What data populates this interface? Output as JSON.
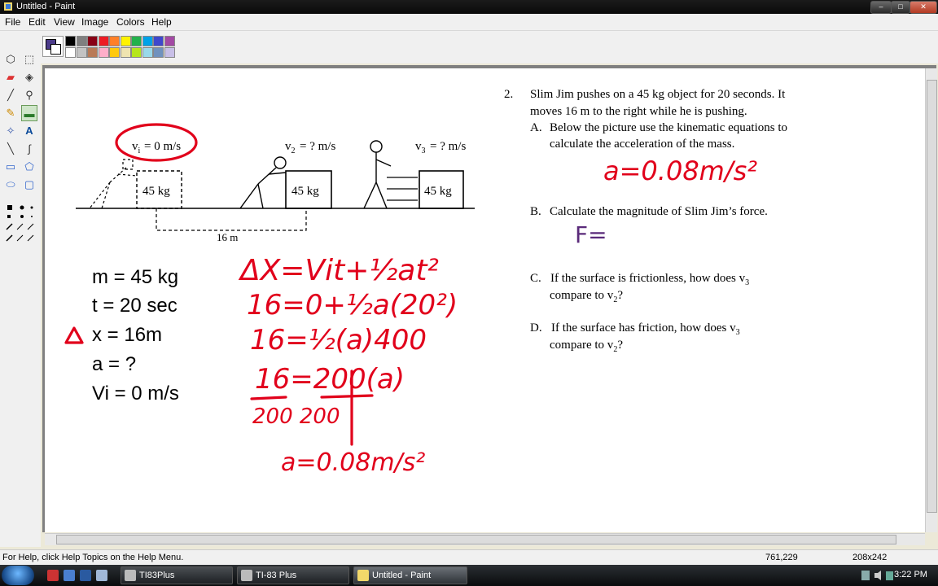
{
  "window": {
    "title": "Untitled - Paint",
    "buttons": [
      "–",
      "□",
      "✕"
    ]
  },
  "menu": [
    "File",
    "Edit",
    "View",
    "Image",
    "Colors",
    "Help"
  ],
  "palette": {
    "foreground": "#4b3b8a",
    "background": "#ffffff",
    "row1": [
      "#000000",
      "#808080",
      "#800000",
      "#808000",
      "#008000",
      "#008080",
      "#000080",
      "#800080",
      "#808040",
      "#004040",
      "#0080ff",
      "#004080",
      "#4000ff",
      "#804000"
    ],
    "row2": [
      "#ffffff",
      "#c0c0c0",
      "#ff0000",
      "#ffff00",
      "#00ff00",
      "#00ffff",
      "#0000ff",
      "#ff00ff",
      "#ffff80",
      "#00ff80",
      "#80ffff",
      "#8080ff",
      "#ff0080",
      "#ff8040"
    ],
    "row1_ui": [
      "#000000",
      "#7f7f7f",
      "#880015",
      "#ed1c24",
      "#ff7f27",
      "#fff200",
      "#22b14c",
      "#00a2e8",
      "#3f48cc",
      "#a349a4"
    ],
    "row2_ui": [
      "#ffffff",
      "#c3c3c3",
      "#b97a57",
      "#ffaec9",
      "#ffc90e",
      "#efe4b0",
      "#b5e61d",
      "#99d9ea",
      "#7092be",
      "#c8bfe7"
    ]
  },
  "tools": [
    {
      "name": "free-form-select",
      "glyph": "⬡"
    },
    {
      "name": "select",
      "glyph": "⬚"
    },
    {
      "name": "eraser",
      "glyph": "▰"
    },
    {
      "name": "fill",
      "glyph": "◈"
    },
    {
      "name": "color-picker",
      "glyph": "╱"
    },
    {
      "name": "magnifier",
      "glyph": "⚲"
    },
    {
      "name": "pencil",
      "glyph": "✎"
    },
    {
      "name": "brush",
      "glyph": "▬"
    },
    {
      "name": "airbrush",
      "glyph": "✧"
    },
    {
      "name": "text",
      "glyph": "A"
    },
    {
      "name": "line",
      "glyph": "╲"
    },
    {
      "name": "curve",
      "glyph": "∫"
    },
    {
      "name": "rectangle",
      "glyph": "▭"
    },
    {
      "name": "polygon",
      "glyph": "⬠"
    },
    {
      "name": "ellipse",
      "glyph": "⬭"
    },
    {
      "name": "rounded-rectangle",
      "glyph": "▢"
    }
  ],
  "diagram": {
    "vi_label": "= 0 m/s",
    "v2_label": "= ? m/s",
    "v3_label": "= ? m/s",
    "box_label": "45 kg",
    "distance_label": "16 m"
  },
  "givens": {
    "m": "m = 45 kg",
    "t": "t = 20 sec",
    "dx": "x = 16m",
    "a": "a = ?",
    "vi": "Vi = 0 m/s"
  },
  "handwriting": {
    "l1": "ΔX=Vit+½at²",
    "l2": "16=0+½a(20²)",
    "l3": "16=½(a)400",
    "l4": "16=200(a)",
    "l5": "200   200",
    "l6": "a=0.08m/s²",
    "answer_a": "a=0.08m/s²",
    "answer_b": "F="
  },
  "problem": {
    "number": "2.",
    "text1": "Slim Jim pushes on a 45 kg object for 20 seconds.  It",
    "text2": "moves 16 m to the right while he is pushing.",
    "a_label": "A.",
    "a1": "Below the picture use the kinematic equations to",
    "a2": "calculate the acceleration of the mass.",
    "b_label": "B.",
    "b1": "Calculate the magnitude of Slim Jim’s force.",
    "c_label": "C.",
    "c1": "If the surface is frictionless, how does v",
    "c2": "compare to v",
    "d_label": "D.",
    "d1": "If the surface has friction, how does v",
    "d2": "compare to v"
  },
  "status": {
    "help": "For Help, click Help Topics on the Help Menu.",
    "coords": "761,229",
    "size": "208x242"
  },
  "taskbar": {
    "items": [
      "TI83Plus",
      "TI-83 Plus",
      "Untitled - Paint"
    ],
    "clock": "3:22 PM"
  }
}
